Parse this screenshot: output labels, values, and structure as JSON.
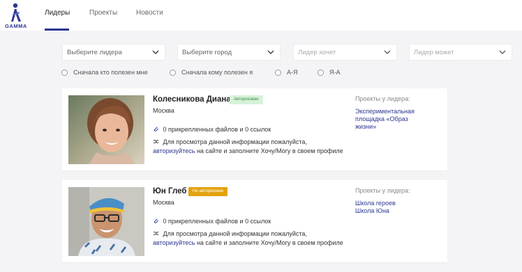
{
  "logo": {
    "text": "GAMMA",
    "brand_color": "#2c3691"
  },
  "nav": {
    "tabs": [
      {
        "label": "Лидеры",
        "active": true
      },
      {
        "label": "Проекты",
        "active": false
      },
      {
        "label": "Новости",
        "active": false
      }
    ]
  },
  "filters": {
    "leader": "Выберите лидера",
    "city": "Выберите город",
    "wants": "Лидер хочет",
    "can": "Лидер может"
  },
  "sort": {
    "options": [
      "Сначала кто полезен мне",
      "Сначала кому полезен я",
      "А-Я",
      "Я-А"
    ]
  },
  "leaders": [
    {
      "name": "Колесникова Диана",
      "status": "Авторизован",
      "city": "Москва",
      "files_count": "0",
      "files_text": "прикрепленных файлов и",
      "links_count": "0",
      "links_text": "ссылок",
      "info_line1": "Для просмотра данной информации пожалуйста,",
      "auth_link": "авторизуйтесь",
      "info_line2": "на сайте и заполните Хочу/Могу в своем профиле",
      "projects_title": "Проекты у лидера:",
      "projects": [
        "Экспериментальная",
        "площадка «Образ",
        "жизни»"
      ]
    },
    {
      "name": "Юн Глеб",
      "status": "Не авторизован",
      "city": "Москва",
      "files_count": "0",
      "files_text": "прикрепленных файлов и",
      "links_count": "0",
      "links_text": "ссылок",
      "info_line1": "Для просмотра данной информации пожалуйста,",
      "auth_link": "авторизуйтесь",
      "info_line2": "на сайте и заполните Хочу/Могу в своем профиле",
      "projects_title": "Проекты у лидера:",
      "projects": [
        "Школа героев",
        "Школа Юна"
      ]
    }
  ]
}
